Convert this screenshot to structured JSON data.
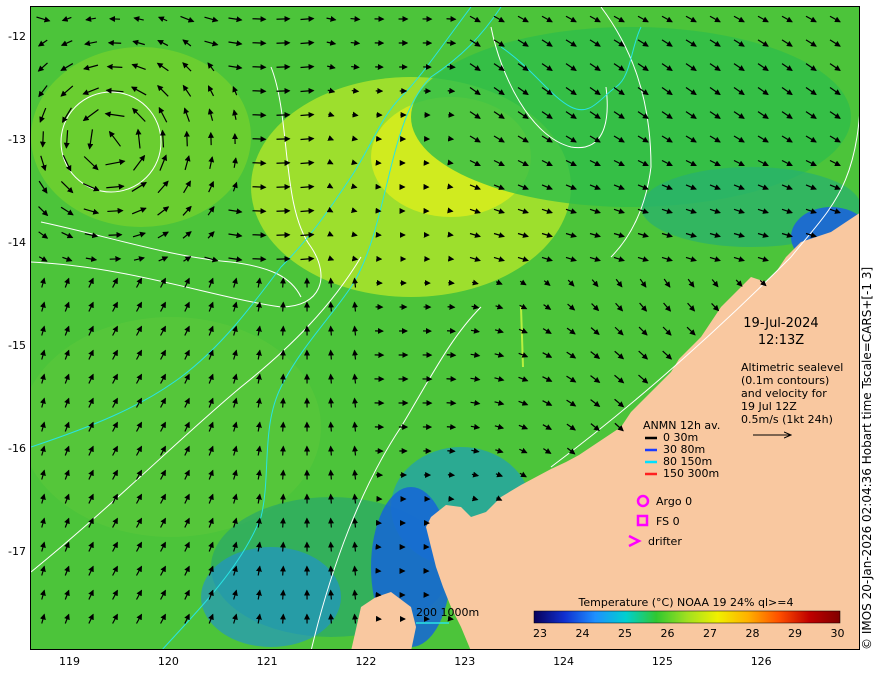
{
  "map": {
    "lon_range": [
      118.6,
      127.0
    ],
    "lat_range": [
      -17.95,
      -11.7
    ],
    "lon_ticks": [
      "119",
      "120",
      "121",
      "122",
      "123",
      "124",
      "125",
      "126"
    ],
    "lat_ticks": [
      "-12",
      "-13",
      "-14",
      "-15",
      "-16",
      "-17"
    ],
    "colors": {
      "land": "#f9c8a0",
      "ocean_base": "#4cc43a",
      "contour": "#ffffff",
      "isobath": "#29e3e3"
    }
  },
  "datetime": {
    "date": "19-Jul-2024",
    "time": "12:13Z"
  },
  "altimetry_note": {
    "line1": "Altimetric sealevel",
    "line2": "(0.1m contours)",
    "line3": "and velocity for",
    "line4": "19 Jul 12Z",
    "line5": "0.5m/s (1kt 24h)"
  },
  "anmn_legend": {
    "title": "ANMN 12h av.",
    "items": [
      {
        "label": "0 30m",
        "color": "#000000"
      },
      {
        "label": "30 80m",
        "color": "#1a3cff"
      },
      {
        "label": "80 150m",
        "color": "#00e0ff"
      },
      {
        "label": "150 300m",
        "color": "#ff2020"
      }
    ]
  },
  "symbols_legend": {
    "argo": "Argo 0",
    "fs": "FS 0",
    "drifter": "drifter",
    "color": "#ff00ff"
  },
  "isobath_legend": "200  1000m",
  "colorbar": {
    "title": "Temperature (°C) NOAA 19 24% ql>=4",
    "ticks": [
      "23",
      "24",
      "25",
      "26",
      "27",
      "28",
      "29",
      "30"
    ],
    "stops": [
      "#08005a",
      "#1030d0",
      "#1e90ff",
      "#00d0d0",
      "#30c830",
      "#a0e020",
      "#f0f000",
      "#ffb000",
      "#ff5000",
      "#c00000",
      "#800000"
    ]
  },
  "credit": "© IMOS 20-Jan-2026 02:04:36 Hobart time Tscale=CARS+[-1 3]"
}
